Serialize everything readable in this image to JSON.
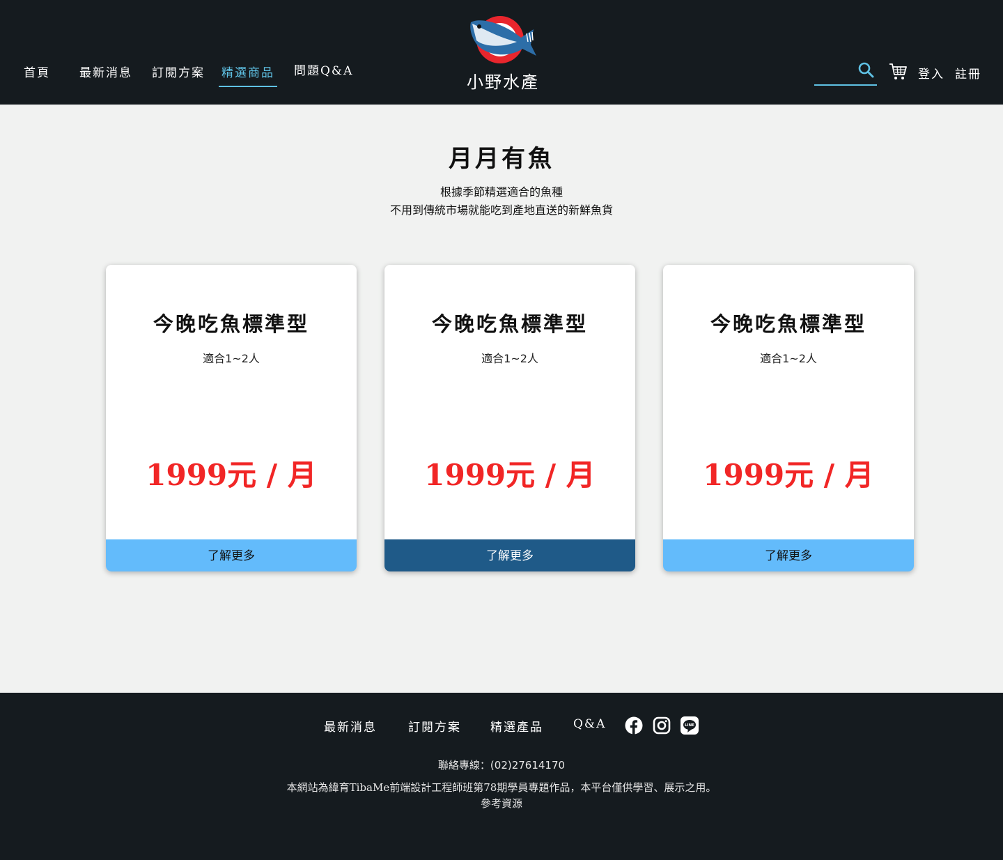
{
  "header": {
    "nav": [
      "首頁",
      "最新消息",
      "訂閱方案",
      "精選商品",
      "問題Q&A"
    ],
    "logo_text": "小野水產",
    "search_placeholder": "",
    "login": "登入",
    "register": "註冊"
  },
  "hero": {
    "title": "月月有魚",
    "line1": "根據季節精選適合的魚種",
    "line2": "不用到傳統市場就能吃到產地直送的新鮮魚貨"
  },
  "cards": [
    {
      "title": "今晚吃魚標準型",
      "people": "適合1~2人",
      "price": "1999元 / 月",
      "button": "了解更多"
    },
    {
      "title": "今晚吃魚標準型",
      "people": "適合1~2人",
      "price": "1999元 / 月",
      "button": "了解更多"
    },
    {
      "title": "今晚吃魚標準型",
      "people": "適合1~2人",
      "price": "1999元 / 月",
      "button": "了解更多"
    }
  ],
  "footer": {
    "nav": [
      "最新消息",
      "訂閱方案",
      "精選產品",
      "Q&A"
    ],
    "social": [
      "facebook-icon",
      "instagram-icon",
      "line-icon"
    ],
    "contact": "聯絡專線：(02)27614170",
    "note": "本網站為緯育TibaMe前端設計工程師班第78期學員專題作品，本平台僅供學習、展示之用。",
    "reference": "參考資源"
  },
  "colors": {
    "dark": "#151b1f",
    "accent": "#5fc1e4",
    "price": "#f12626",
    "button_light": "#63bbfb",
    "button_dark": "#1f5a88"
  }
}
